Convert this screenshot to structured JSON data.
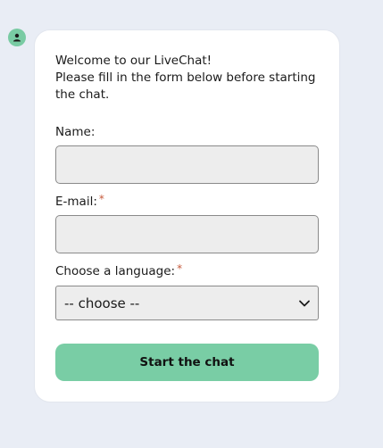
{
  "welcome": {
    "line1": "Welcome to our LiveChat!",
    "line2": "Please fill in the form below before starting the chat."
  },
  "form": {
    "name_label": "Name:",
    "name_value": "",
    "email_label": "E-mail:",
    "email_value": "",
    "required_marker": "*",
    "language_label": "Choose a language:",
    "language_selected": "-- choose --",
    "submit_label": "Start the chat"
  },
  "icons": {
    "avatar": "user-icon",
    "select_arrow": "chevron-down-icon"
  },
  "colors": {
    "background": "#e9edf5",
    "accent": "#79cda5",
    "required": "#c65a3c",
    "field_bg": "#ededed"
  }
}
